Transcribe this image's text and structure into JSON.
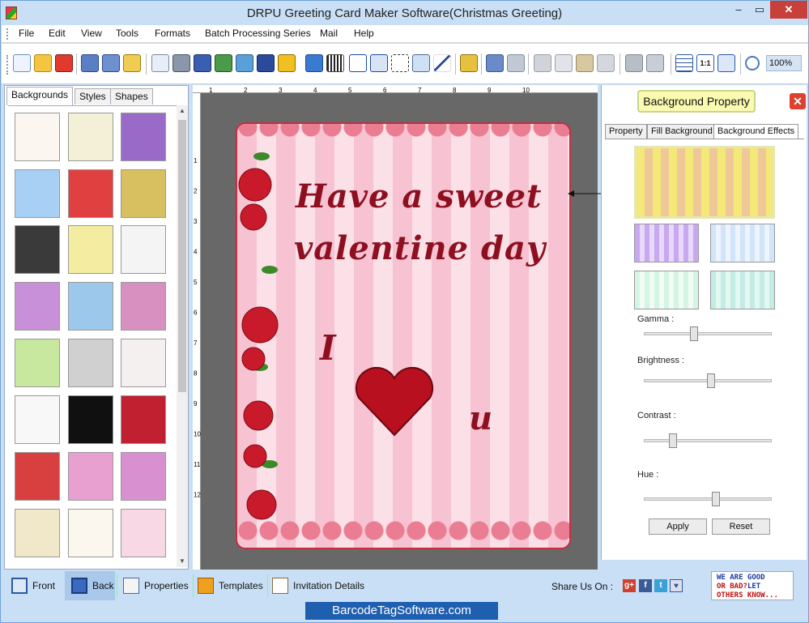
{
  "window": {
    "title": "DRPU Greeting Card Maker Software(Christmas Greeting)",
    "controls": {
      "minimize": "–",
      "maximize": "▭",
      "close": "✕"
    }
  },
  "menu": [
    "File",
    "Edit",
    "View",
    "Tools",
    "Formats",
    "Batch Processing Series",
    "Mail",
    "Help"
  ],
  "toolbar": {
    "icons": [
      "new-icon",
      "open-icon",
      "close-file-icon",
      "save-icon",
      "save-as-icon",
      "export-icon",
      "page-setup-icon",
      "print-icon",
      "print-preview-icon",
      "draw-icon",
      "image-icon",
      "pencil-icon",
      "shape-icon",
      "wordart-icon",
      "barcode-icon",
      "text-icon",
      "text-style-icon",
      "signature-icon",
      "mail-icon",
      "line-icon",
      "database-icon",
      "undo-icon",
      "redo-icon",
      "cut-icon",
      "copy-icon",
      "paste-icon",
      "delete-icon",
      "bring-front-icon",
      "send-back-icon",
      "grid-icon",
      "actual-size-icon",
      "fit-window-icon",
      "zoom-icon"
    ],
    "zoom": "100%"
  },
  "left_panel": {
    "tabs": [
      "Backgrounds",
      "Styles",
      "Shapes"
    ],
    "active_tab": "Backgrounds"
  },
  "ruler": {
    "top": [
      "1",
      "2",
      "3",
      "4",
      "5",
      "6",
      "7",
      "8",
      "9",
      "10"
    ],
    "left": [
      "1",
      "2",
      "3",
      "4",
      "5",
      "6",
      "7",
      "8",
      "9",
      "10",
      "11",
      "12"
    ]
  },
  "card": {
    "line1": "Have a sweet",
    "line2": "valentine day",
    "letter_i": "I",
    "letter_u": "u"
  },
  "right_panel": {
    "title": "Background Property",
    "close": "✕",
    "tabs": [
      "Property",
      "Fill Background",
      "Background Effects"
    ],
    "active_tab": "Background Effects",
    "sliders": [
      {
        "label": "Gamma :",
        "value": 0.38
      },
      {
        "label": "Brightness :",
        "value": 0.52
      },
      {
        "label": "Contrast :",
        "value": 0.2
      },
      {
        "label": "Hue :",
        "value": 0.56
      }
    ],
    "apply": "Apply",
    "reset": "Reset"
  },
  "bottom_bar": {
    "front": "Front",
    "back": "Back",
    "properties": "Properties",
    "templates": "Templates",
    "invitation": "Invitation Details",
    "share": "Share Us On :",
    "feedback": {
      "line1": "WE ARE GOOD",
      "line2a": "OR BAD?",
      "line2b": "LET",
      "line3": "OTHERS KNOW..."
    }
  },
  "footer": "BarcodeTagSoftware.com",
  "colors": {
    "accent": "#8e1020",
    "panel": "#c8dff5"
  }
}
